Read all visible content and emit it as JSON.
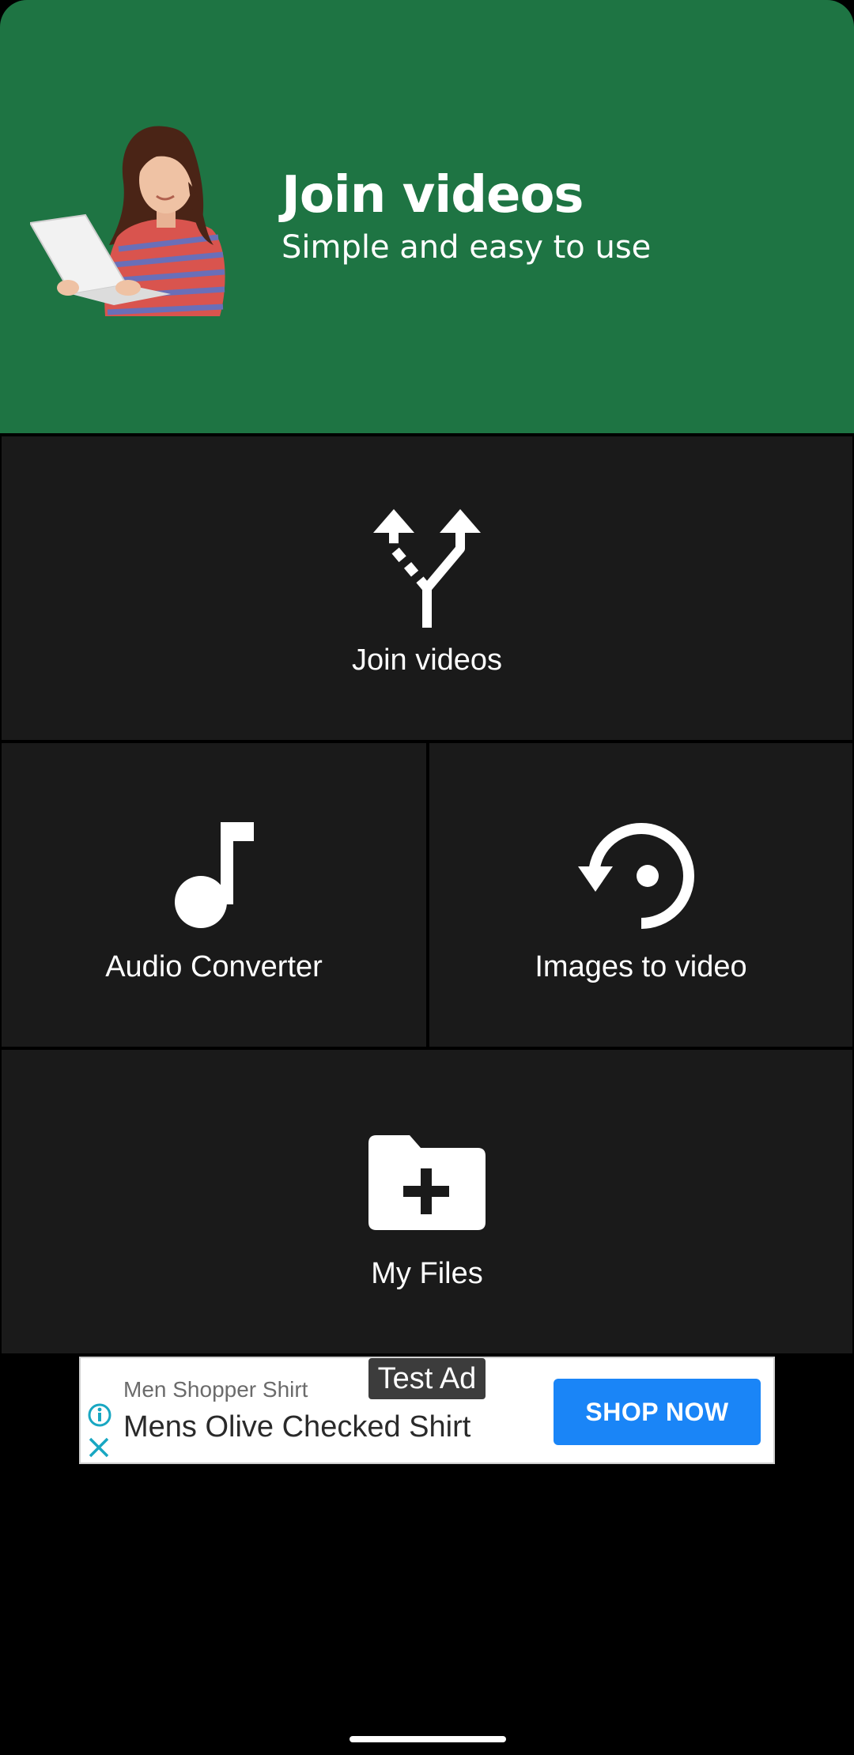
{
  "header": {
    "title": "Join videos",
    "subtitle": "Simple and easy to use",
    "background_color": "#1e7443",
    "hero_image": "woman-with-laptop"
  },
  "tiles": [
    {
      "label": "Join videos",
      "icon": "merge-arrows-icon"
    },
    {
      "label": "Audio Converter",
      "icon": "music-note-icon"
    },
    {
      "label": "Images to video",
      "icon": "rotate-left-icon"
    },
    {
      "label": "My Files",
      "icon": "folder-add-icon"
    }
  ],
  "ad": {
    "badge": "Test Ad",
    "brand": "Men Shopper Shirt",
    "title": "Mens Olive Checked Shirt",
    "cta": "SHOP NOW",
    "cta_color": "#1a85f7",
    "info_icon": "info-icon",
    "close_icon": "close-icon"
  }
}
